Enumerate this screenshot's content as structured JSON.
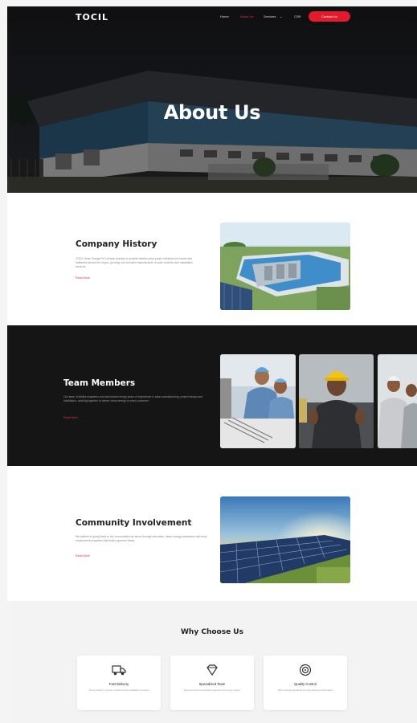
{
  "nav": {
    "logo": "TOCIL",
    "links": [
      "Home",
      "About Us",
      "Services",
      "CSR"
    ],
    "contact_label": "Contact Us"
  },
  "hero": {
    "title": "About Us"
  },
  "history": {
    "heading": "Company History",
    "body": "TOCIL Solar Energy Pvt Ltd was founded to provide reliable solar power solutions for homes and industries across the region, growing into a trusted manufacturer of solar modules and installation services.",
    "link": "Read More"
  },
  "team": {
    "heading": "Team Members",
    "body": "Our team of skilled engineers and technicians brings years of experience in solar manufacturing, project design and installation, working together to deliver clean energy to every customer.",
    "link": "Read More"
  },
  "community": {
    "heading": "Community Involvement",
    "body": "We believe in giving back to the communities we serve through education, clean energy awareness and local employment programs that build a greener future.",
    "link": "Read More"
  },
  "why": {
    "title": "Why Choose Us",
    "cards": [
      {
        "title": "Fast Delivery",
        "desc": "Timely delivery of solar products and installation services",
        "icon": "truck-icon"
      },
      {
        "title": "Specialized Team",
        "desc": "Experienced and certified engineers for every project",
        "icon": "diamond-icon"
      },
      {
        "title": "Quality Control",
        "desc": "Strict testing standards for long lasting performance",
        "icon": "target-icon"
      }
    ]
  },
  "colors": {
    "accent": "#e8323b",
    "dark_band": "#151515",
    "button": "#e11b2b"
  }
}
